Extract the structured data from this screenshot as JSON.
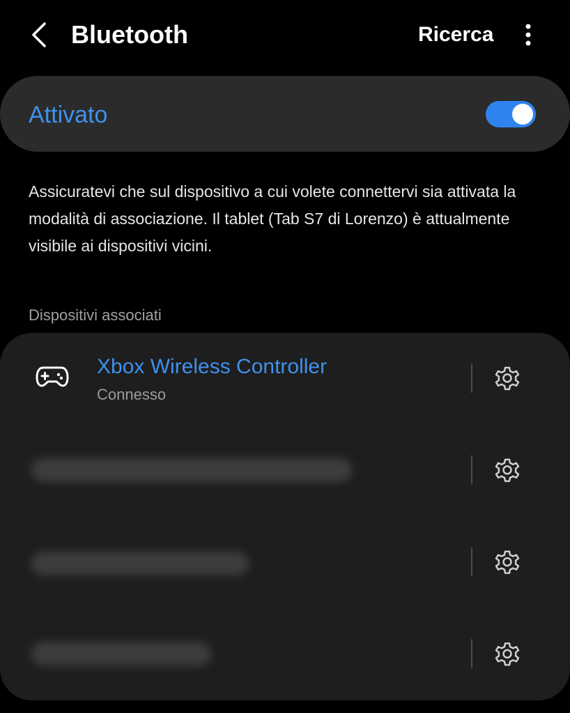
{
  "header": {
    "title": "Bluetooth",
    "search_label": "Ricerca",
    "back_icon": "chevron-left-icon",
    "more_icon": "more-vertical-icon"
  },
  "toggle": {
    "label": "Attivato",
    "state": "on",
    "accent_color": "#3e91ee"
  },
  "info_text": "Assicuratevi che sul dispositivo a cui volete connettervi sia attivata la modalità di associazione. Il tablet (Tab S7 di Lorenzo) è attualmente visibile ai dispositivi vicini.",
  "paired_section": {
    "header": "Dispositivi associati",
    "devices": [
      {
        "name": "Xbox Wireless Controller",
        "status": "Connesso",
        "icon": "gamepad-icon",
        "settings_icon": "gear-icon"
      },
      {
        "name": "",
        "status": "",
        "redacted": true,
        "settings_icon": "gear-icon"
      },
      {
        "name": "",
        "status": "",
        "redacted": true,
        "settings_icon": "gear-icon"
      },
      {
        "name": "",
        "status": "",
        "redacted": true,
        "settings_icon": "gear-icon"
      }
    ]
  }
}
